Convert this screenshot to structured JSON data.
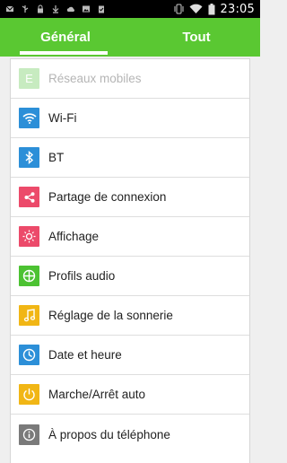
{
  "status_bar": {
    "time": "23:05",
    "left_icons": [
      "message-icon",
      "usb-icon",
      "lock-icon",
      "download-icon",
      "cloud-icon",
      "photo-icon",
      "clipboard-icon"
    ],
    "right_icons": [
      "vibrate-icon",
      "wifi-icon",
      "battery-icon"
    ]
  },
  "tabs": {
    "general_label": "Général",
    "tout_label": "Tout",
    "active": "Général"
  },
  "settings": {
    "items": [
      {
        "label": "Réseaux mobiles",
        "icon": "E",
        "color": "#c7ebc0",
        "disabled": true
      },
      {
        "label": "Wi-Fi",
        "icon": "wifi-icon",
        "color": "#2c8fd8"
      },
      {
        "label": "BT",
        "icon": "bluetooth-icon",
        "color": "#2c8fd8"
      },
      {
        "label": "Partage de connexion",
        "icon": "share-icon",
        "color": "#ec4a6a"
      },
      {
        "label": "Affichage",
        "icon": "brightness-icon",
        "color": "#ec4a6a"
      },
      {
        "label": "Profils audio",
        "icon": "audio-profile-icon",
        "color": "#4cc232"
      },
      {
        "label": "Réglage de la sonnerie",
        "icon": "music-note-icon",
        "color": "#f1b615"
      },
      {
        "label": "Date et heure",
        "icon": "clock-icon",
        "color": "#2c8fd8"
      },
      {
        "label": "Marche/Arrêt auto",
        "icon": "power-icon",
        "color": "#f1b615"
      },
      {
        "label": "À propos du téléphone",
        "icon": "info-icon",
        "color": "#7a7a7a"
      }
    ]
  }
}
